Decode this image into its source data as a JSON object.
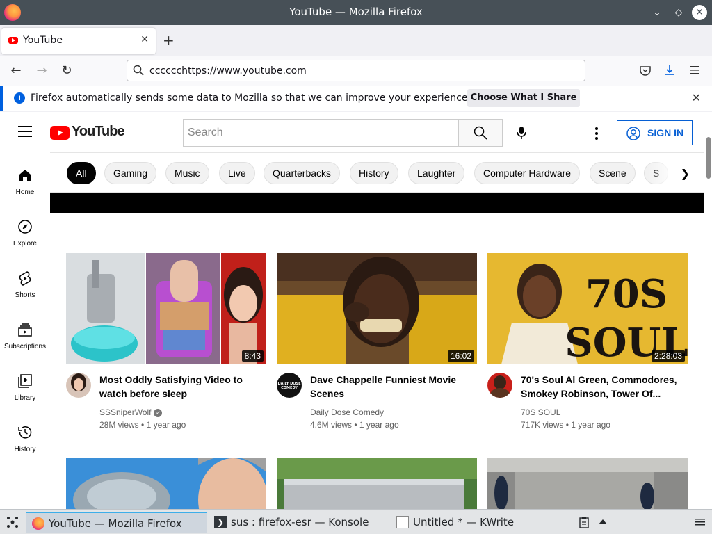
{
  "window": {
    "title": "YouTube — Mozilla Firefox"
  },
  "tabs": [
    {
      "title": "YouTube"
    }
  ],
  "navbar": {
    "url": "cccccchttps://www.youtube.com"
  },
  "notification": {
    "text": "Firefox automatically sends some data to Mozilla so that we can improve your experience.",
    "button": "Choose What I Share"
  },
  "youtube": {
    "logo_text": "YouTube",
    "search_placeholder": "Search",
    "signin_label": "SIGN IN",
    "sidebar": [
      {
        "label": "Home",
        "icon": "home-icon"
      },
      {
        "label": "Explore",
        "icon": "compass-icon"
      },
      {
        "label": "Shorts",
        "icon": "shorts-icon"
      },
      {
        "label": "Subscriptions",
        "icon": "subscriptions-icon"
      },
      {
        "label": "Library",
        "icon": "library-icon"
      },
      {
        "label": "History",
        "icon": "history-icon"
      }
    ],
    "chips": [
      "All",
      "Gaming",
      "Music",
      "Live",
      "Quarterbacks",
      "History",
      "Laughter",
      "Computer Hardware",
      "Scene",
      "S"
    ],
    "videos": [
      {
        "title": "Most Oddly Satisfying Video to watch before sleep",
        "channel": "SSSniperWolf",
        "verified": true,
        "views": "28M views",
        "age": "1 year ago",
        "duration": "8:43"
      },
      {
        "title": "Dave Chappelle Funniest Movie Scenes",
        "channel": "Daily Dose Comedy",
        "verified": false,
        "views": "4.6M views",
        "age": "1 year ago",
        "duration": "16:02",
        "avatar_text": "DAILY DOSE COMEDY"
      },
      {
        "title": "70's Soul Al Green, Commodores, Smokey Robinson, Tower Of...",
        "channel": "70S SOUL",
        "verified": false,
        "views": "717K views",
        "age": "1 year ago",
        "duration": "2:28:03",
        "thumb_text_1": "70S",
        "thumb_text_2": "SOUL"
      }
    ],
    "meta_separator": "•"
  },
  "taskbar": {
    "tasks": [
      {
        "label": "YouTube — Mozilla Firefox"
      },
      {
        "label": "sus : firefox-esr — Konsole"
      },
      {
        "label": "Untitled * — KWrite"
      }
    ]
  },
  "colors": {
    "titlebar": "#475057",
    "yt_red": "#ff0000",
    "link_blue": "#065fd4",
    "notif_accent": "#0060df"
  }
}
